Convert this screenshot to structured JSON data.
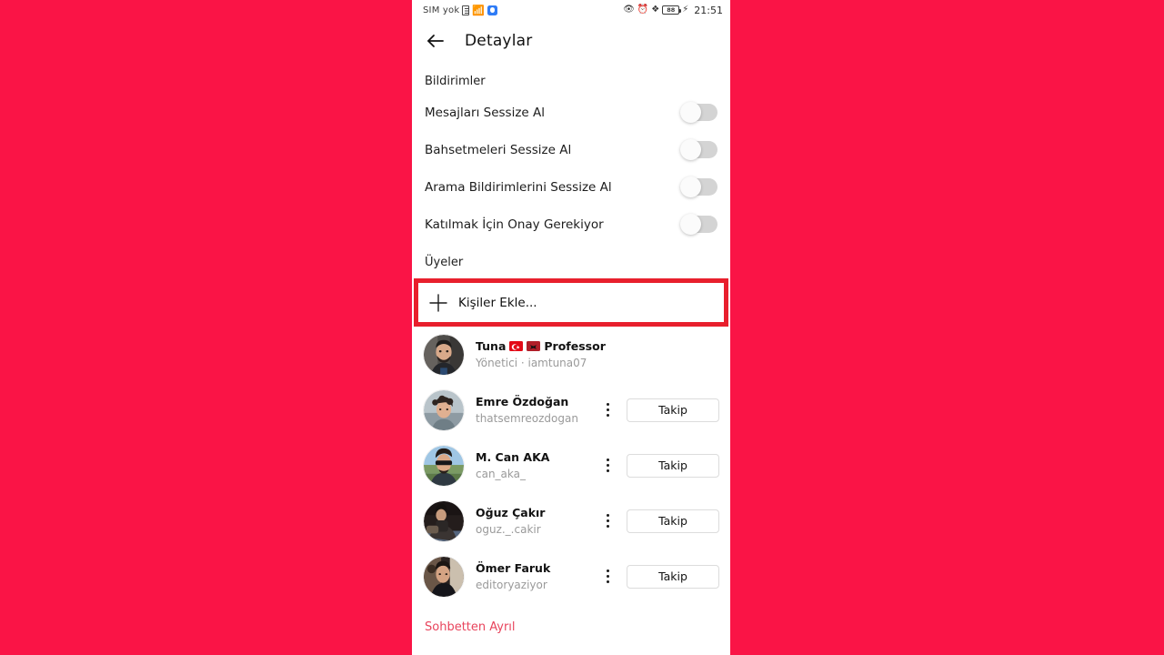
{
  "statusbar": {
    "sim_text": "SIM yok",
    "sim_card_icon": "sim-card-icon",
    "wifi_icon": "wifi-icon",
    "app_icon": "blue-app-icon",
    "eye_icon": "eye-icon",
    "alarm_icon": "alarm-icon",
    "bluetooth_icon": "bluetooth-icon",
    "battery_level": "88",
    "charging_icon": "bolt-icon",
    "time": "21:51"
  },
  "header": {
    "back_icon": "back-arrow-icon",
    "title": "Detaylar"
  },
  "notifications": {
    "section_label": "Bildirimler",
    "rows": [
      {
        "label": "Mesajları Sessize Al",
        "state": "off"
      },
      {
        "label": "Bahsetmeleri Sessize Al",
        "state": "off"
      },
      {
        "label": "Arama Bildirimlerini Sessize Al",
        "state": "off"
      },
      {
        "label": "Katılmak İçin Onay Gerekiyor",
        "state": "off"
      }
    ]
  },
  "members": {
    "section_label": "Üyeler",
    "add_people": {
      "label": "Kişiler Ekle...",
      "plus_icon": "plus-icon",
      "highlight_color": "#E81F2D"
    },
    "list": [
      {
        "name": "Tuna",
        "suffix": "Professor",
        "flags": [
          "turkey-flag",
          "albania-flag"
        ],
        "handle": "Yönetici · iamtuna07",
        "has_menu": false,
        "has_follow": false,
        "follow_label": ""
      },
      {
        "name": "Emre Özdoğan",
        "suffix": "",
        "flags": [],
        "handle": "thatsemreozdogan",
        "has_menu": true,
        "has_follow": true,
        "follow_label": "Takip"
      },
      {
        "name": "M. Can AKA",
        "suffix": "",
        "flags": [],
        "handle": "can_aka_",
        "has_menu": true,
        "has_follow": true,
        "follow_label": "Takip"
      },
      {
        "name": "Oğuz Çakır",
        "suffix": "",
        "flags": [],
        "handle": "oguz._.cakir",
        "has_menu": true,
        "has_follow": true,
        "follow_label": "Takip"
      },
      {
        "name": "Ömer Faruk",
        "suffix": "",
        "flags": [],
        "handle": "editoryaziyor",
        "has_menu": true,
        "has_follow": true,
        "follow_label": "Takip"
      }
    ]
  },
  "footer": {
    "leave_label": "Sohbetten Ayrıl",
    "leave_color": "#E8445C"
  },
  "background_color": "#FA1446"
}
